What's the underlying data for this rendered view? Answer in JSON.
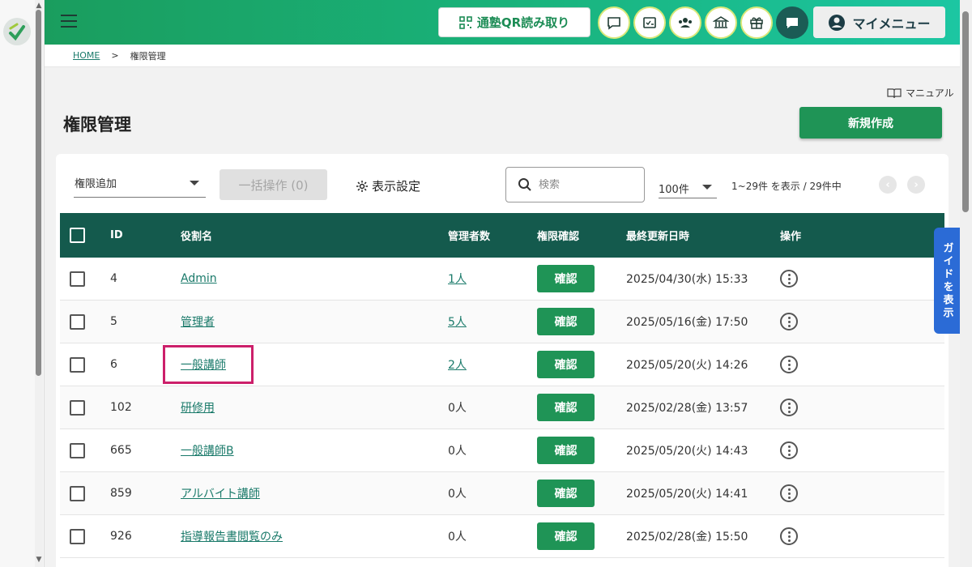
{
  "header": {
    "qr_button_label": "通塾QR読み取り",
    "my_menu_label": "マイメニュー"
  },
  "breadcrumb": {
    "home": "HOME",
    "separator": ">",
    "current": "権限管理"
  },
  "page": {
    "manual_label": "マニュアル",
    "title": "権限管理",
    "new_button_label": "新規作成"
  },
  "toolbar": {
    "permission_select_value": "権限追加",
    "bulk_action_label": "一括操作 (0)",
    "display_settings_label": "表示設定",
    "search_placeholder": "検索",
    "per_page_value": "100件",
    "range_text": "1~29件 を表示 / 29件中"
  },
  "table": {
    "headers": {
      "id": "ID",
      "role": "役割名",
      "admins": "管理者数",
      "confirm": "権限確認",
      "updated": "最終更新日時",
      "ops": "操作"
    },
    "confirm_label": "確認",
    "rows": [
      {
        "id": "4",
        "role": "Admin",
        "admins": "1人",
        "admins_link": true,
        "updated": "2025/04/30(水) 15:33"
      },
      {
        "id": "5",
        "role": "管理者",
        "admins": "5人",
        "admins_link": true,
        "updated": "2025/05/16(金) 17:50"
      },
      {
        "id": "6",
        "role": "一般講師",
        "admins": "2人",
        "admins_link": true,
        "updated": "2025/05/20(火) 14:26"
      },
      {
        "id": "102",
        "role": "研修用",
        "admins": "0人",
        "admins_link": false,
        "updated": "2025/02/28(金) 13:57"
      },
      {
        "id": "665",
        "role": "一般講師B",
        "admins": "0人",
        "admins_link": false,
        "updated": "2025/05/20(火) 14:43"
      },
      {
        "id": "859",
        "role": "アルバイト講師",
        "admins": "0人",
        "admins_link": false,
        "updated": "2025/05/20(火) 14:41"
      },
      {
        "id": "926",
        "role": "指導報告書閲覧のみ",
        "admins": "0人",
        "admins_link": false,
        "updated": "2025/02/28(金) 15:50"
      }
    ]
  },
  "guide_tab_label": "ガイドを表示",
  "colors": {
    "primary_green": "#1f9456",
    "table_header": "#145a4d",
    "link": "#1a7a6a",
    "highlight": "#cc1f6a",
    "guide_blue": "#2b6bd6"
  }
}
